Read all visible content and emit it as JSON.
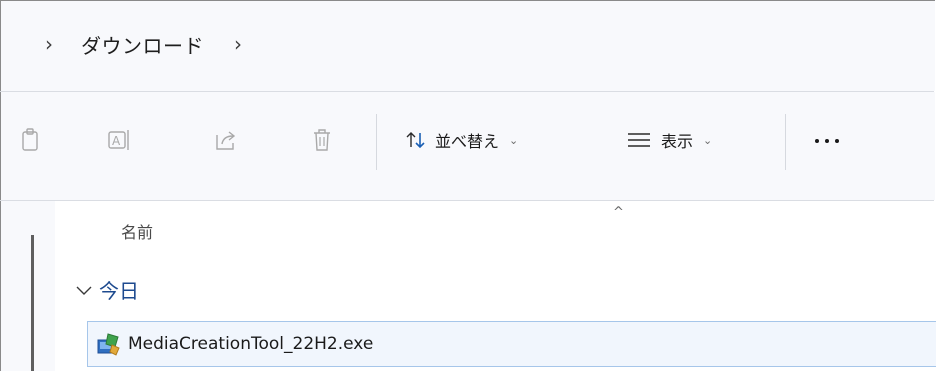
{
  "address_bar": {
    "breadcrumb_chevron_left": "›",
    "folder": "ダウンロード",
    "breadcrumb_chevron_right": "›"
  },
  "toolbar": {
    "icons": [
      "copy-icon",
      "rename-icon",
      "share-icon",
      "delete-icon"
    ],
    "sort_label": "並べ替え",
    "view_label": "表示",
    "dropdown_glyph": "⌄",
    "more_label": "..."
  },
  "file_list": {
    "sort_indicator": "^",
    "column_name": "名前",
    "group_label": "今日",
    "files": [
      {
        "name": "MediaCreationTool_22H2.exe",
        "icon": "installer-icon"
      }
    ]
  },
  "colors": {
    "accent": "#1d4a8f",
    "selection_bg": "#f1f6fd",
    "selection_border": "#a6c6ea",
    "chrome_bg": "#f8f9fc"
  }
}
